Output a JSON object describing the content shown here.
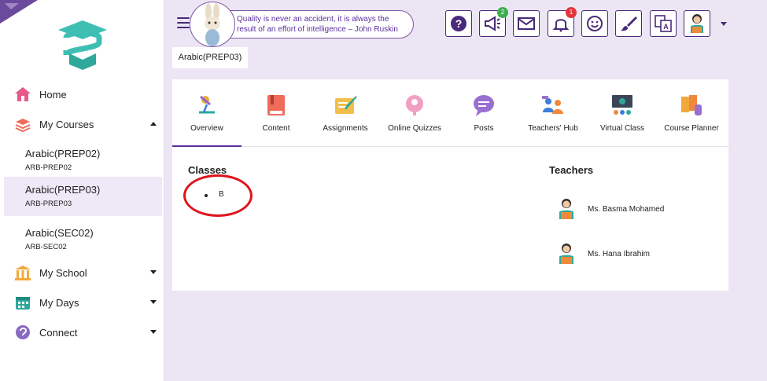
{
  "sidebar": {
    "home_label": "Home",
    "my_courses_label": "My Courses",
    "courses": [
      {
        "name": "Arabic(PREP02)",
        "code": "ARB-PREP02"
      },
      {
        "name": "Arabic(PREP03)",
        "code": "ARB-PREP03"
      },
      {
        "name": "Arabic(SEC02)",
        "code": "ARB-SEC02"
      }
    ],
    "my_school_label": "My School",
    "my_days_label": "My Days",
    "connect_label": "Connect"
  },
  "header": {
    "quote": "Quality is never an accident, it is always the result of an effort of intelligence – John Ruskin",
    "announcements_badge": "2",
    "notifications_badge": "1"
  },
  "breadcrumb": "Arabic(PREP03)",
  "tabs": [
    {
      "label": "Overview"
    },
    {
      "label": "Content"
    },
    {
      "label": "Assignments"
    },
    {
      "label": "Online Quizzes"
    },
    {
      "label": "Posts"
    },
    {
      "label": "Teachers' Hub"
    },
    {
      "label": "Virtual Class"
    },
    {
      "label": "Course Planner"
    }
  ],
  "overview": {
    "classes_title": "Classes",
    "classes": [
      "B"
    ],
    "teachers_title": "Teachers",
    "teachers": [
      "Ms. Basma Mohamed",
      "Ms. Hana Ibrahim"
    ]
  },
  "colors": {
    "accent": "#5a2fa0",
    "badge_green": "#3fae4f",
    "badge_red": "#e5343b",
    "annotation_red": "#e0141c"
  }
}
